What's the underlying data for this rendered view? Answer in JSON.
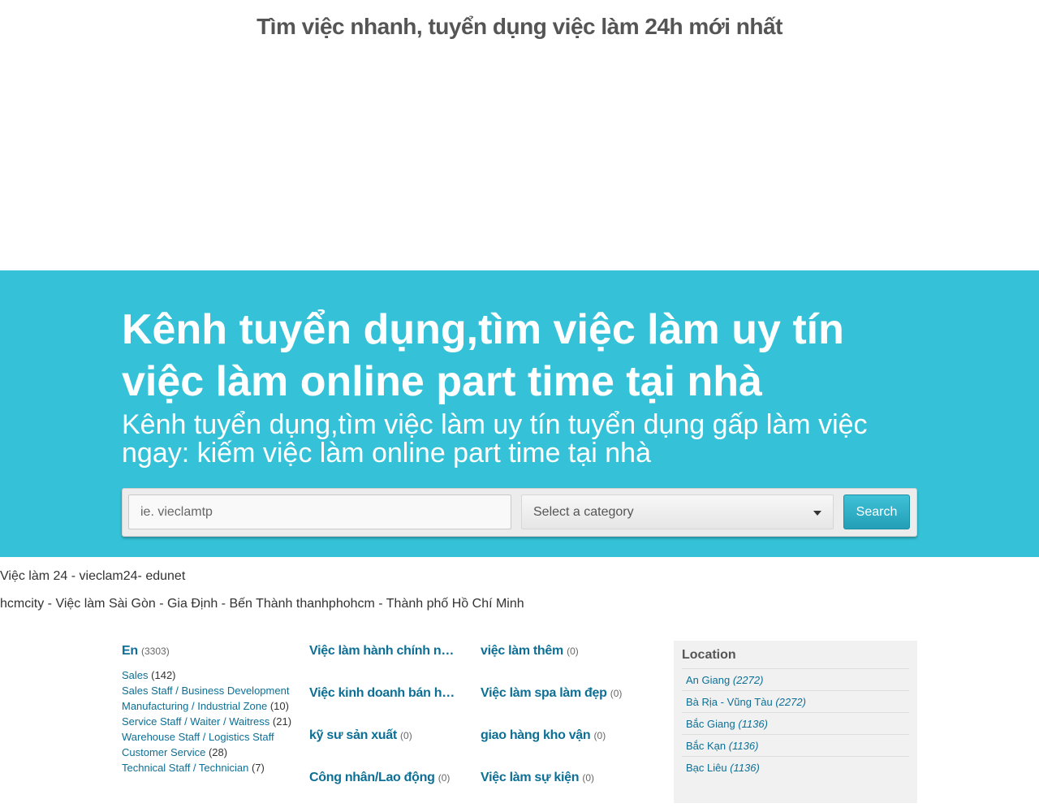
{
  "page": {
    "top_title": "Tìm việc nhanh, tuyển dụng việc làm 24h mới nhất"
  },
  "hero": {
    "title": "Kênh tuyển dụng,tìm việc làm uy tín việc làm online part time tại nhà",
    "subtitle": "Kênh tuyển dụng,tìm việc làm uy tín tuyển dụng gấp làm việc ngay: kiếm việc làm online part time tại nhà"
  },
  "search": {
    "placeholder": "ie. vieclamtp",
    "category_selected": "Select a category",
    "button_label": "Search"
  },
  "site_name": "Việc làm 24 - vieclam24- edunet",
  "breadcrumb": "hcmcity - Việc làm Sài Gòn - Gia Định - Bến Thành thanhphohcm - Thành phố Hồ Chí Minh",
  "categories": {
    "col1": {
      "name": "En",
      "count": "(3303)",
      "subcategories": [
        {
          "name": "Sales",
          "count": "(142)"
        },
        {
          "name": "Sales Staff / Business Development",
          "count": ""
        },
        {
          "name": "Manufacturing / Industrial Zone",
          "count": "(10)"
        },
        {
          "name": "Service Staff / Waiter / Waitress",
          "count": "(21)"
        },
        {
          "name": "Warehouse Staff / Logistics Staff",
          "count": ""
        },
        {
          "name": "Customer Service",
          "count": "(28)"
        },
        {
          "name": "Technical Staff / Technician",
          "count": "(7)"
        }
      ]
    },
    "col2": [
      {
        "name": "Việc làm hành chính nhân sự",
        "count": ""
      },
      {
        "name": "Việc kinh doanh bán hàng",
        "count": ""
      },
      {
        "name": "kỹ sư sản xuất",
        "count": "(0)"
      },
      {
        "name": "Công nhân/Lao động",
        "count": "(0)"
      }
    ],
    "col3": [
      {
        "name": "việc làm thêm",
        "count": "(0)"
      },
      {
        "name": "Việc làm spa làm đẹp",
        "count": "(0)"
      },
      {
        "name": "giao hàng kho vận",
        "count": "(0)"
      },
      {
        "name": "Việc làm sự kiện",
        "count": "(0)"
      }
    ]
  },
  "location": {
    "title": "Location",
    "items": [
      {
        "name": "An Giang",
        "count": "(2272)"
      },
      {
        "name": "Bà Rịa - Vũng Tàu",
        "count": "(2272)"
      },
      {
        "name": "Bắc Giang",
        "count": "(1136)"
      },
      {
        "name": "Bắc Kạn",
        "count": "(1136)"
      },
      {
        "name": "Bạc Liêu",
        "count": "(1136)"
      }
    ]
  },
  "colors": {
    "hero_bg": "#35c2d8",
    "link": "#0d6f95",
    "button": "#239fb7"
  }
}
